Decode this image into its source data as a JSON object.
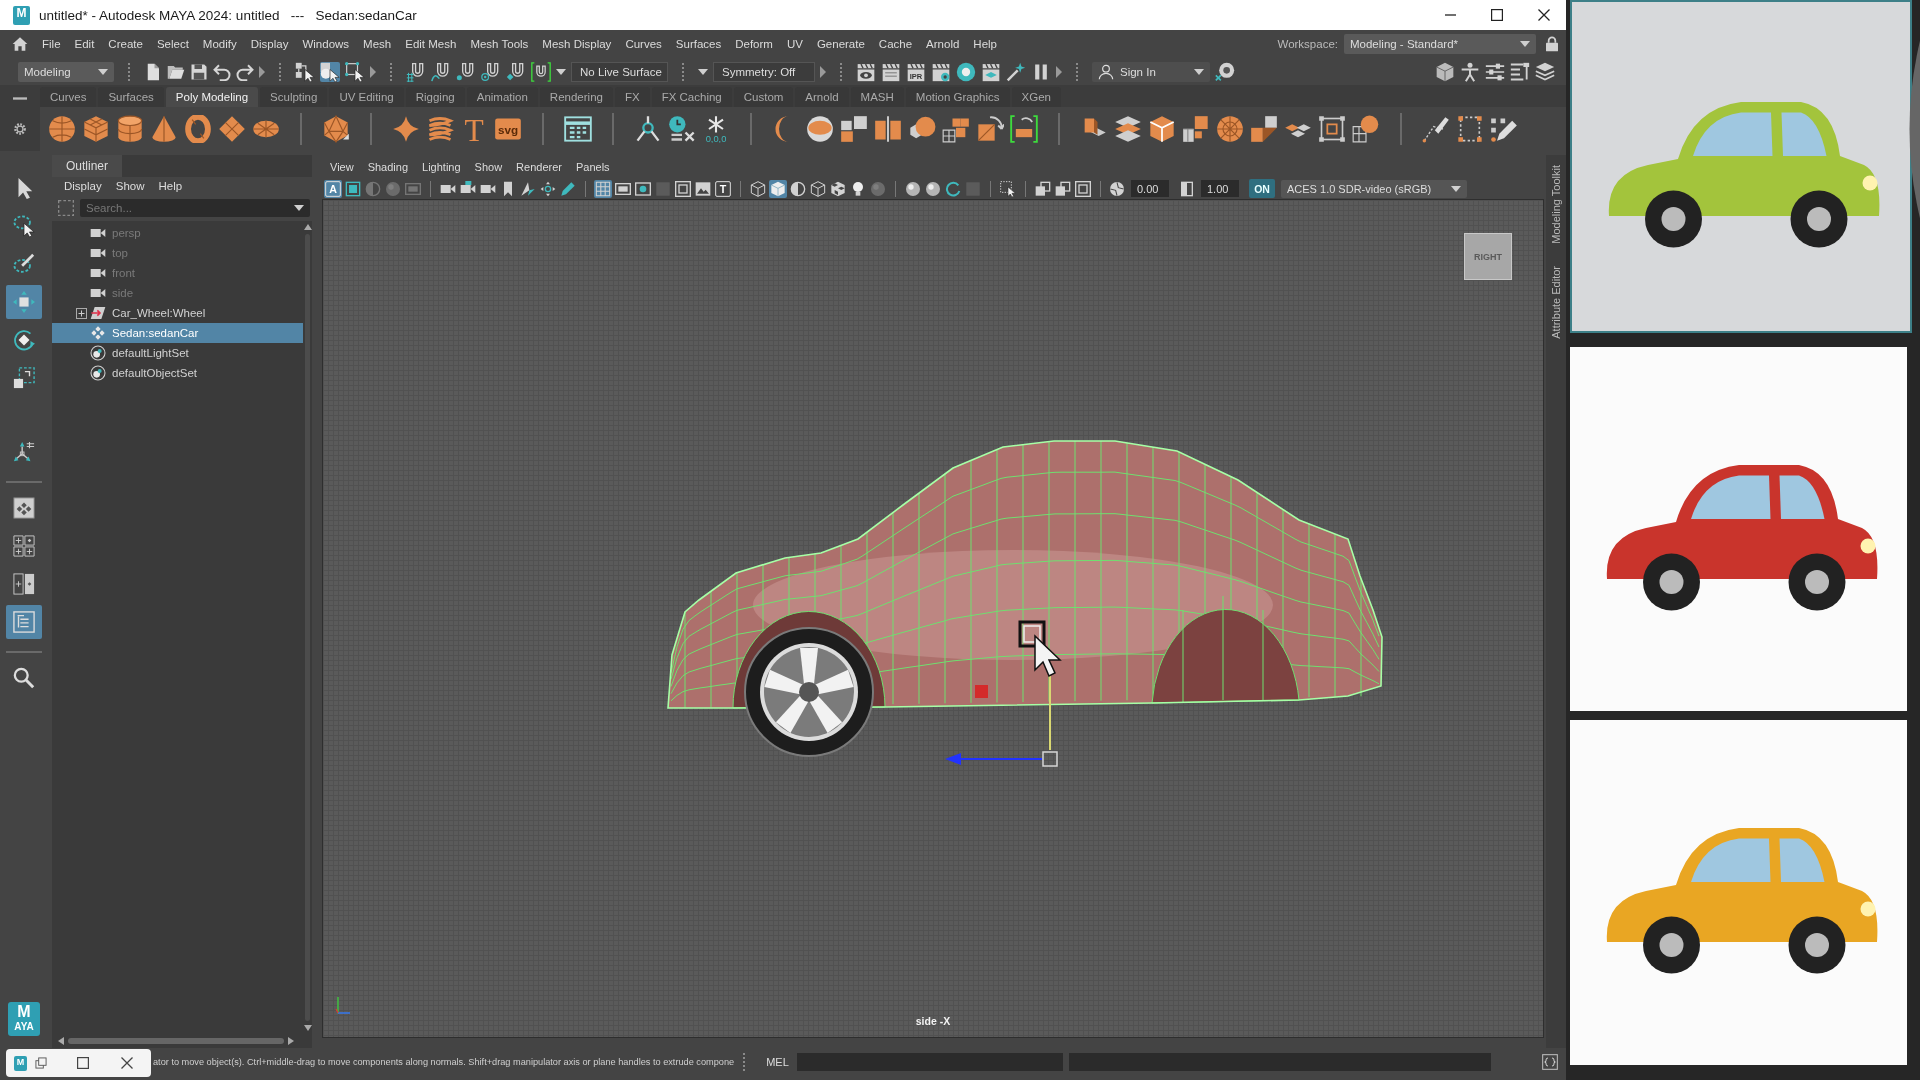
{
  "window": {
    "logo": "M",
    "title": "untitled* - Autodesk MAYA 2024: untitled   ---   Sedan:sedanCar"
  },
  "menu_bar": {
    "items": [
      "File",
      "Edit",
      "Create",
      "Select",
      "Modify",
      "Display",
      "Windows",
      "Mesh",
      "Edit Mesh",
      "Mesh Tools",
      "Mesh Display",
      "Curves",
      "Surfaces",
      "Deform",
      "UV",
      "Generate",
      "Cache",
      "Arnold",
      "Help"
    ],
    "workspace_label": "Workspace:",
    "workspace": "Modeling - Standard*"
  },
  "status_line": {
    "menu_set": "Modeling",
    "selection_modes": [
      {
        "kind": "hierarchy",
        "selected": false
      },
      {
        "kind": "object",
        "selected": true
      },
      {
        "kind": "component",
        "selected": false
      }
    ],
    "live_surface": "No Live Surface",
    "symmetry": "Symmetry: Off",
    "ipr_label": "IPR",
    "sign_in": "Sign In"
  },
  "shelf": {
    "tabs": [
      {
        "label": "Curves",
        "selected": false
      },
      {
        "label": "Surfaces",
        "selected": false
      },
      {
        "label": "Poly Modeling",
        "selected": true
      },
      {
        "label": "Sculpting",
        "selected": false
      },
      {
        "label": "UV Editing",
        "selected": false
      },
      {
        "label": "Rigging",
        "selected": false
      },
      {
        "label": "Animation",
        "selected": false
      },
      {
        "label": "Rendering",
        "selected": false
      },
      {
        "label": "FX",
        "selected": false
      },
      {
        "label": "FX Caching",
        "selected": false
      },
      {
        "label": "Custom",
        "selected": false
      },
      {
        "label": "Arnold",
        "selected": false
      },
      {
        "label": "MASH",
        "selected": false
      },
      {
        "label": "Motion Graphics",
        "selected": false
      },
      {
        "label": "XGen",
        "selected": false
      }
    ],
    "type_tool": "T",
    "svg_tool": "svg",
    "freeze_label": "0,0,0"
  },
  "toolbox": {
    "tools": [
      {
        "kind": "select",
        "selected": false
      },
      {
        "kind": "lasso",
        "selected": false
      },
      {
        "kind": "paint",
        "selected": false
      },
      {
        "kind": "move",
        "selected": true
      },
      {
        "kind": "rotate",
        "selected": false
      },
      {
        "kind": "scale",
        "selected": false
      },
      {
        "kind": "manip",
        "selected": false
      }
    ],
    "layouts": [
      {
        "kind": "single",
        "selected": false
      },
      {
        "kind": "four",
        "selected": false
      },
      {
        "kind": "split",
        "selected": false
      },
      {
        "kind": "outliner",
        "selected": true
      }
    ],
    "logo": "M",
    "logo_caption": "AYA"
  },
  "outliner": {
    "title": "Outliner",
    "menus": [
      "Display",
      "Show",
      "Help"
    ],
    "search": {
      "placeholder": "Search..."
    },
    "items": [
      {
        "label": "persp",
        "kind": "camera",
        "hidden": true,
        "selected": false
      },
      {
        "label": "top",
        "kind": "camera",
        "hidden": true,
        "selected": false
      },
      {
        "label": "front",
        "kind": "camera",
        "hidden": true,
        "selected": false
      },
      {
        "label": "side",
        "kind": "camera",
        "hidden": true,
        "selected": false
      },
      {
        "label": "Car_Wheel:Wheel",
        "kind": "group",
        "hidden": false,
        "selected": false,
        "expanded": false
      },
      {
        "label": "Sedan:sedanCar",
        "kind": "mesh",
        "hidden": false,
        "selected": true
      },
      {
        "label": "defaultLightSet",
        "kind": "set",
        "hidden": false,
        "selected": false
      },
      {
        "label": "defaultObjectSet",
        "kind": "set",
        "hidden": false,
        "selected": false
      }
    ]
  },
  "viewport": {
    "menus": [
      "View",
      "Shading",
      "Lighting",
      "Show",
      "Renderer",
      "Panels"
    ],
    "toolbar": [
      [
        {
          "kind": "letter",
          "text": "A",
          "on": true,
          "disabled": false
        },
        {
          "kind": "frame",
          "on": false,
          "disabled": false
        },
        {
          "kind": "half",
          "on": false,
          "disabled": true
        },
        {
          "kind": "sphere",
          "on": false,
          "disabled": true
        },
        {
          "kind": "film",
          "on": false,
          "disabled": true
        }
      ],
      [
        {
          "kind": "camera",
          "on": false,
          "disabled": false
        },
        {
          "kind": "lock",
          "on": false,
          "disabled": false
        },
        {
          "kind": "camera",
          "on": false,
          "disabled": false
        },
        {
          "kind": "bookmark",
          "on": false,
          "disabled": false
        },
        {
          "kind": "leaf",
          "on": false,
          "disabled": false
        },
        {
          "kind": "pan",
          "on": false,
          "disabled": false
        },
        {
          "kind": "pencil",
          "on": false,
          "disabled": false
        }
      ],
      [
        {
          "kind": "grid",
          "on": true,
          "disabled": false
        },
        {
          "kind": "film",
          "on": false,
          "disabled": false
        },
        {
          "kind": "gate",
          "on": false,
          "disabled": false
        },
        {
          "kind": "square",
          "on": false,
          "disabled": true
        },
        {
          "kind": "field",
          "on": false,
          "disabled": false
        },
        {
          "kind": "picture",
          "on": false,
          "disabled": false
        },
        {
          "kind": "letter",
          "text": "T",
          "on": false,
          "disabled": false
        }
      ],
      [
        {
          "kind": "wire",
          "on": false,
          "disabled": false
        },
        {
          "kind": "solid",
          "on": true,
          "disabled": false
        },
        {
          "kind": "half",
          "on": false,
          "disabled": false
        },
        {
          "kind": "wire",
          "on": false,
          "disabled": false
        },
        {
          "kind": "checker",
          "on": false,
          "disabled": false
        },
        {
          "kind": "bulb",
          "on": false,
          "disabled": false
        },
        {
          "kind": "sphere",
          "on": false,
          "disabled": true
        }
      ],
      [
        {
          "kind": "sphere",
          "on": false,
          "disabled": false
        },
        {
          "kind": "sphere",
          "on": false,
          "disabled": false
        },
        {
          "kind": "ring",
          "on": false,
          "disabled": false
        },
        {
          "kind": "square",
          "on": false,
          "disabled": true
        }
      ],
      [
        {
          "kind": "isolate",
          "on": false,
          "disabled": false
        }
      ],
      [
        {
          "kind": "xray",
          "on": false,
          "disabled": false
        },
        {
          "kind": "xray",
          "on": false,
          "disabled": false
        },
        {
          "kind": "field",
          "on": false,
          "disabled": false
        }
      ]
    ],
    "exposure": "0.00",
    "gamma": "1.00",
    "color_management": "ON",
    "color_space": "ACES 1.0 SDR-video (sRGB)",
    "view_cube": "RIGHT",
    "camera": "side -X"
  },
  "side_tabs": [
    "Modeling Toolkit",
    "Attribute Editor"
  ],
  "help_line": {
    "message": "ator to move object(s). Ctrl+middle-drag to move components along normals. Shift+drag manipulator axis or plane handles to extrude compone",
    "mel_label": "MEL"
  },
  "taskbar_preview": {
    "logo": "M"
  },
  "reference_images": [
    {
      "color": "#a3c43c"
    },
    {
      "color": "#c9342c"
    },
    {
      "color": "#e9a623"
    }
  ]
}
